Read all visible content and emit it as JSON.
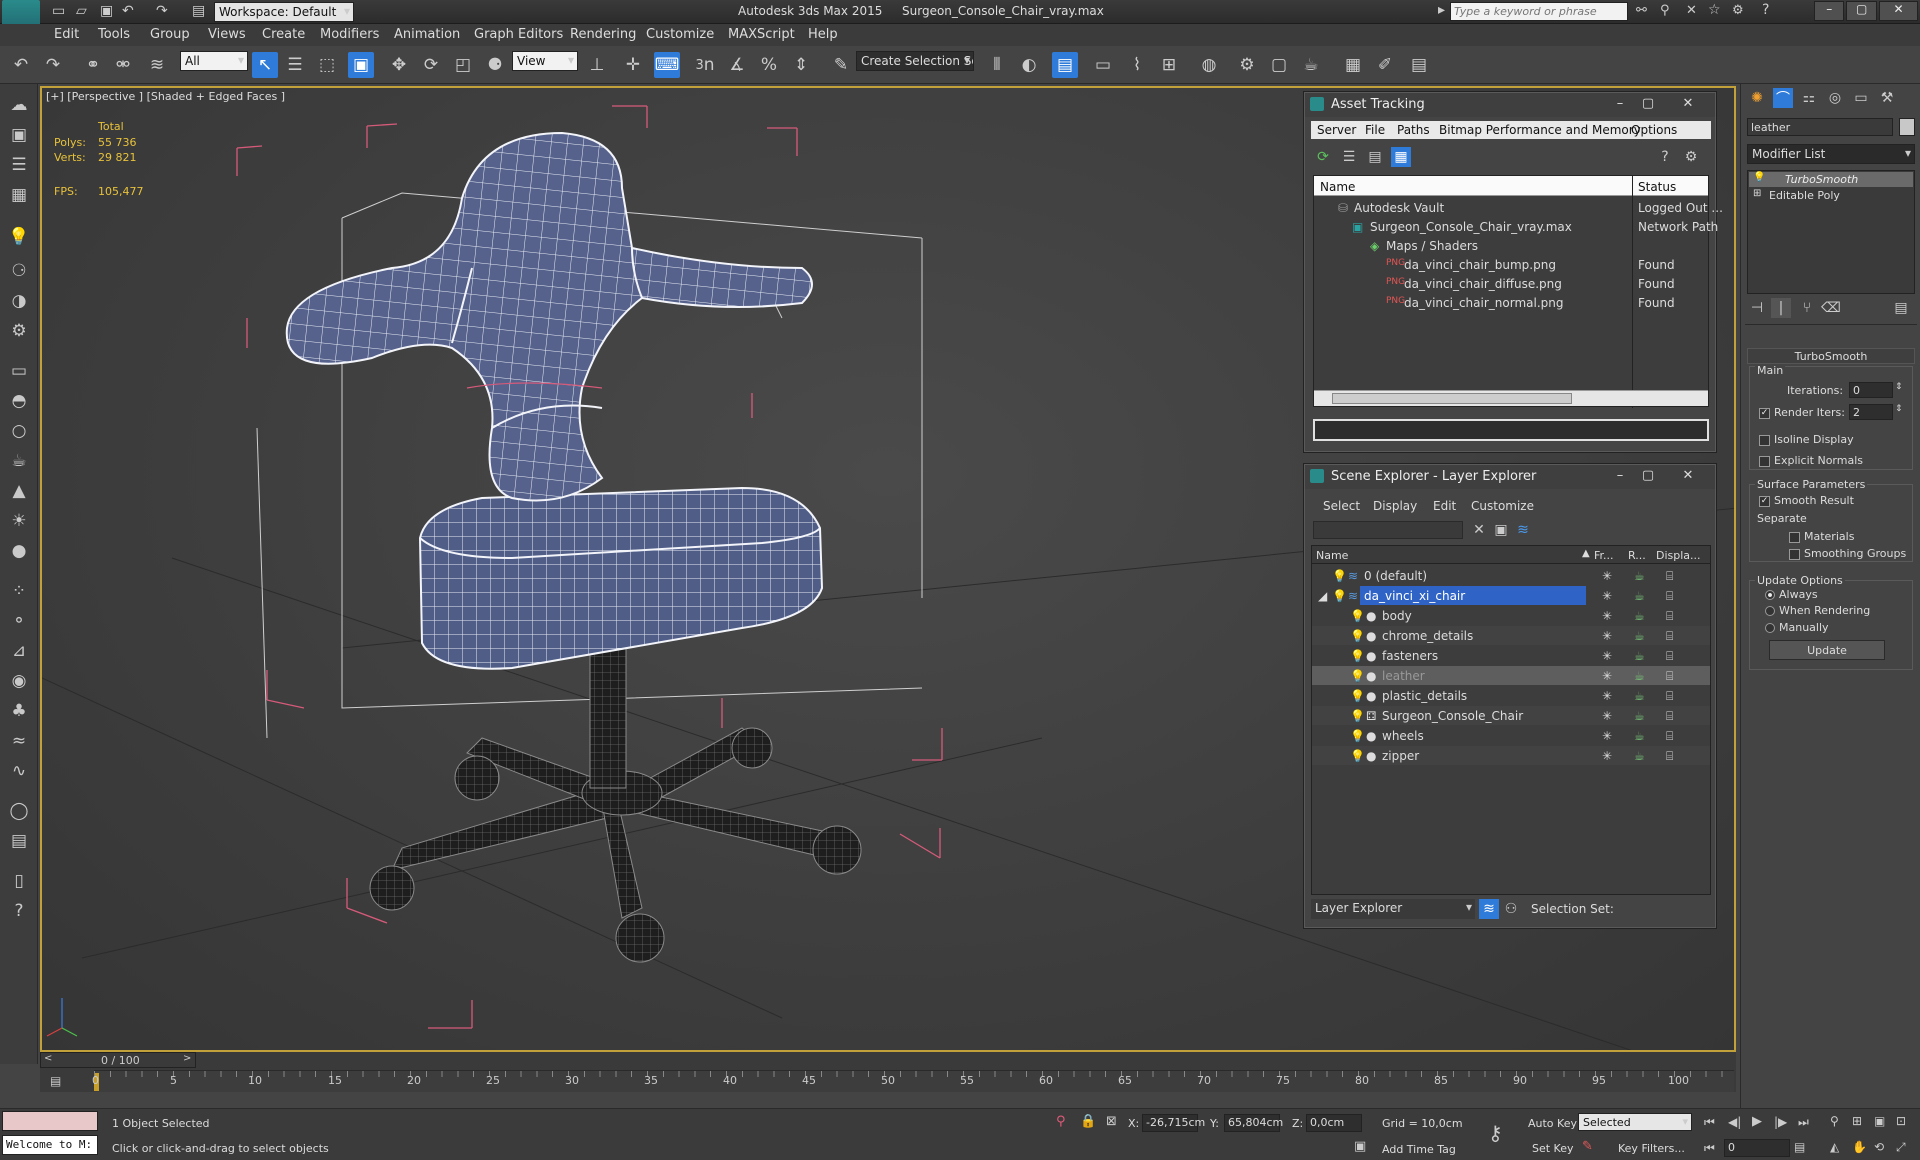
{
  "title": {
    "app": "Autodesk 3ds Max 2015",
    "file": "Surgeon_Console_Chair_vray.max",
    "workspace": "Workspace: Default",
    "search_placeholder": "Type a keyword or phrase"
  },
  "menu": [
    "Edit",
    "Tools",
    "Group",
    "Views",
    "Create",
    "Modifiers",
    "Animation",
    "Graph Editors",
    "Rendering",
    "Customize",
    "MAXScript",
    "Help"
  ],
  "toolbar": {
    "filter": "All",
    "ref_coord": "View",
    "selection_set": "Create Selection Se",
    "snap_3": "3"
  },
  "viewport": {
    "label": "[+] [Perspective ] [Shaded + Edged Faces ]",
    "stats": {
      "total_label": "Total",
      "polys_label": "Polys:",
      "polys": "55 736",
      "verts_label": "Verts:",
      "verts": "29 821",
      "fps_label": "FPS:",
      "fps": "105,477"
    }
  },
  "asset_tracking": {
    "title": "Asset Tracking",
    "menu": [
      "Server",
      "File",
      "Paths",
      "Bitmap Performance and Memory",
      "Options"
    ],
    "columns": [
      "Name",
      "Status"
    ],
    "rows": [
      {
        "name": "Autodesk Vault",
        "status": "Logged Out ..."
      },
      {
        "name": "Surgeon_Console_Chair_vray.max",
        "status": "Network Path"
      },
      {
        "name": "Maps / Shaders",
        "status": ""
      },
      {
        "name": "da_vinci_chair_bump.png",
        "status": "Found"
      },
      {
        "name": "da_vinci_chair_diffuse.png",
        "status": "Found"
      },
      {
        "name": "da_vinci_chair_normal.png",
        "status": "Found"
      }
    ]
  },
  "scene_explorer": {
    "title": "Scene Explorer - Layer Explorer",
    "menu": [
      "Select",
      "Display",
      "Edit",
      "Customize"
    ],
    "columns": [
      "Name",
      "Fr...",
      "R...",
      "Displa..."
    ],
    "rows": [
      {
        "name": "0 (default)",
        "level": 0
      },
      {
        "name": "da_vinci_xi_chair",
        "level": 0
      },
      {
        "name": "body",
        "level": 1
      },
      {
        "name": "chrome_details",
        "level": 1
      },
      {
        "name": "fasteners",
        "level": 1
      },
      {
        "name": "leather",
        "level": 1
      },
      {
        "name": "plastic_details",
        "level": 1
      },
      {
        "name": "Surgeon_Console_Chair",
        "level": 1
      },
      {
        "name": "wheels",
        "level": 1
      },
      {
        "name": "zipper",
        "level": 1
      }
    ],
    "footer_dropdown": "Layer Explorer",
    "selection_set_label": "Selection Set:"
  },
  "command_panel": {
    "object_name": "leather",
    "modifier_list": "Modifier List",
    "stack": [
      "TurboSmooth",
      "Editable Poly"
    ],
    "rollout_title": "TurboSmooth",
    "main_label": "Main",
    "iterations_label": "Iterations:",
    "iterations": "0",
    "render_iters_label": "Render Iters:",
    "render_iters": "2",
    "isoline_label": "Isoline Display",
    "explicit_normals_label": "Explicit Normals",
    "surface_params_label": "Surface Parameters",
    "smooth_result_label": "Smooth Result",
    "separate_label": "Separate",
    "materials_label": "Materials",
    "smoothing_groups_label": "Smoothing Groups",
    "update_options_label": "Update Options",
    "always_label": "Always",
    "when_rendering_label": "When Rendering",
    "manually_label": "Manually",
    "update_button": "Update"
  },
  "timeline": {
    "frame": "0 / 100",
    "ticks": [
      "0",
      "5",
      "10",
      "15",
      "20",
      "25",
      "30",
      "35",
      "40",
      "45",
      "50",
      "55",
      "60",
      "65",
      "70",
      "75",
      "80",
      "85",
      "90",
      "95",
      "100"
    ]
  },
  "status": {
    "welcome": "Welcome to M:",
    "objects_selected": "1 Object Selected",
    "prompt": "Click or click-and-drag to select objects",
    "x_label": "X:",
    "x": "-26,715cm",
    "y_label": "Y:",
    "y": "65,804cm",
    "z_label": "Z:",
    "z": "0,0cm",
    "grid": "Grid = 10,0cm",
    "add_time_tag": "Add Time Tag",
    "auto_key": "Auto Key",
    "set_key": "Set Key",
    "selected": "Selected",
    "key_filters": "Key Filters...",
    "frame_value": "0"
  },
  "colors": {
    "accent": "#2f7bd9",
    "viewport_border": "#c2a13a",
    "stats_text": "#e8c23a",
    "bbox": "#d65a7a"
  }
}
